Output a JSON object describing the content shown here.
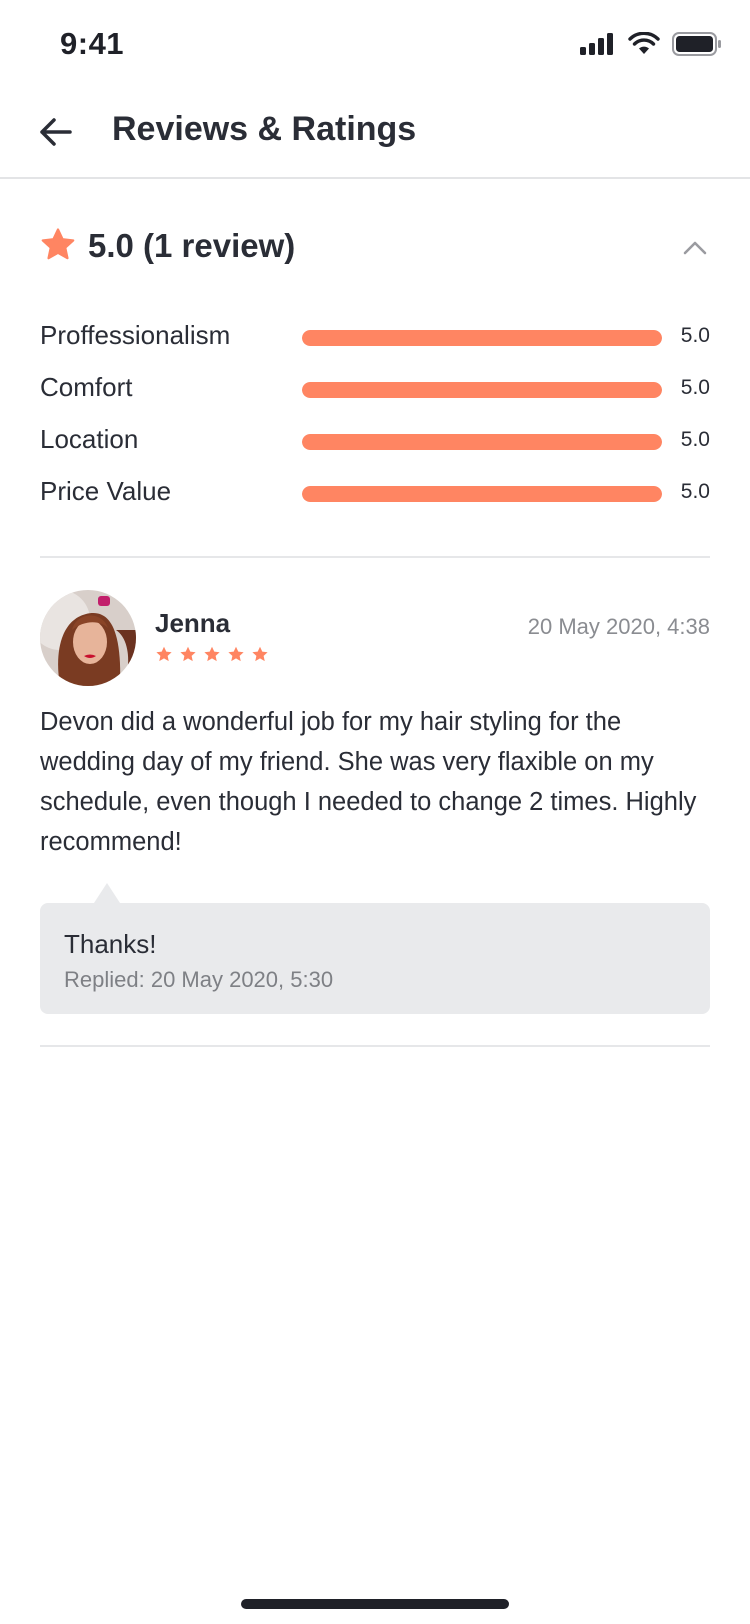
{
  "status_bar": {
    "time": "9:41"
  },
  "header": {
    "title": "Reviews & Ratings",
    "back_icon": "arrow-left-icon"
  },
  "summary": {
    "text": "5.0 (1 review)",
    "star_color": "#ff8562",
    "collapse_icon": "chevron-up-icon"
  },
  "ratings": [
    {
      "label": "Proffessionalism",
      "value": "5.0",
      "fraction": 1.0
    },
    {
      "label": "Comfort",
      "value": "5.0",
      "fraction": 1.0
    },
    {
      "label": "Location",
      "value": "5.0",
      "fraction": 1.0
    },
    {
      "label": "Price Value",
      "value": "5.0",
      "fraction": 1.0
    }
  ],
  "review": {
    "name": "Jenna",
    "stars": 5,
    "date": "20 May 2020, 4:38",
    "text": "Devon did a wonderful job for my hair styling for the wedding day of my friend. She was very flaxible on my schedule, even though I needed to change 2 times. Highly recommend!",
    "reply": {
      "text": "Thanks!",
      "meta": "Replied: 20 May 2020, 5:30"
    }
  },
  "colors": {
    "accent": "#ff8562",
    "text": "#2a2d36",
    "muted": "#8a8c91",
    "reply_bg": "#e9eaec"
  }
}
